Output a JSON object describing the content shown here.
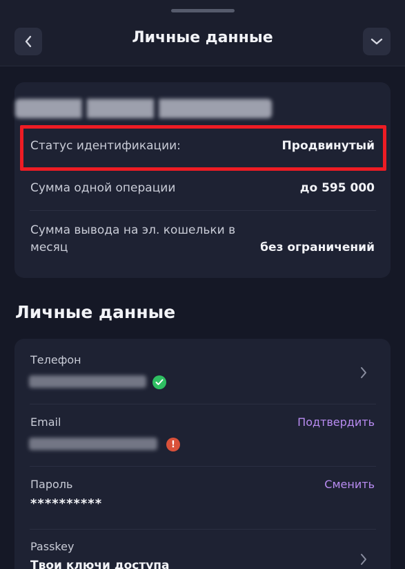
{
  "header": {
    "title": "Личные данные",
    "back_icon": "chevron-left-icon",
    "collapse_icon": "chevron-down-icon"
  },
  "status_card": {
    "rows": [
      {
        "label": "Статус идентификации:",
        "value": "Продвинутый"
      },
      {
        "label": "Сумма одной операции",
        "value": "до 595 000"
      },
      {
        "label": "Сумма вывода на эл. кошельки в месяц",
        "value": "без ограничений"
      }
    ]
  },
  "personal": {
    "section_title": "Личные данные",
    "phone": {
      "label": "Телефон",
      "verified_icon": "check-circle-icon"
    },
    "email": {
      "label": "Email",
      "action": "Подтвердить",
      "warning_icon": "exclamation-circle-icon"
    },
    "password": {
      "label": "Пароль",
      "value": "**********",
      "action": "Сменить"
    },
    "passkey": {
      "label": "Passkey",
      "value": "Твои ключи доступа"
    }
  },
  "colors": {
    "background": "#151826",
    "card": "#1e2233",
    "accent_link": "#b98cf2",
    "highlight_border": "#ee1c24",
    "verified": "#2fbf62",
    "warning": "#d9513a"
  }
}
